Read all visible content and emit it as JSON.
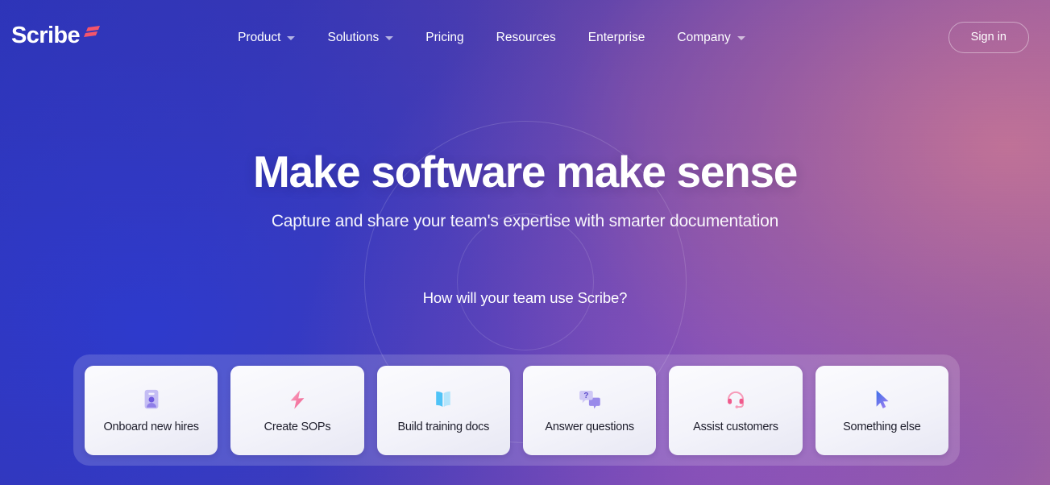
{
  "brand": {
    "logo_text": "Scribe",
    "logo_mark": "scribe-slash-mark",
    "accent_red": "#f4556b",
    "accent_purple": "#6f5ae0"
  },
  "nav": {
    "items": [
      {
        "label": "Product",
        "has_dropdown": true,
        "icon": "chevron-down-icon"
      },
      {
        "label": "Solutions",
        "has_dropdown": true,
        "icon": "chevron-down-icon"
      },
      {
        "label": "Pricing",
        "has_dropdown": false,
        "icon": ""
      },
      {
        "label": "Resources",
        "has_dropdown": false,
        "icon": ""
      },
      {
        "label": "Enterprise",
        "has_dropdown": false,
        "icon": ""
      },
      {
        "label": "Company",
        "has_dropdown": true,
        "icon": "chevron-down-icon"
      }
    ],
    "signin_label": "Sign in"
  },
  "hero": {
    "headline": "Make software make sense",
    "subheadline": "Capture and share your team's expertise with smarter documentation",
    "prompt": "How will your team use Scribe?"
  },
  "use_case_panel": {
    "cards": [
      {
        "label": "Onboard new hires",
        "icon": "id-badge-icon"
      },
      {
        "label": "Create SOPs",
        "icon": "lightning-bolt-icon"
      },
      {
        "label": "Build training docs",
        "icon": "open-book-icon"
      },
      {
        "label": "Answer questions",
        "icon": "question-chat-bubbles-icon"
      },
      {
        "label": "Assist customers",
        "icon": "headset-icon"
      },
      {
        "label": "Something else",
        "icon": "cursor-arrow-icon"
      }
    ]
  }
}
